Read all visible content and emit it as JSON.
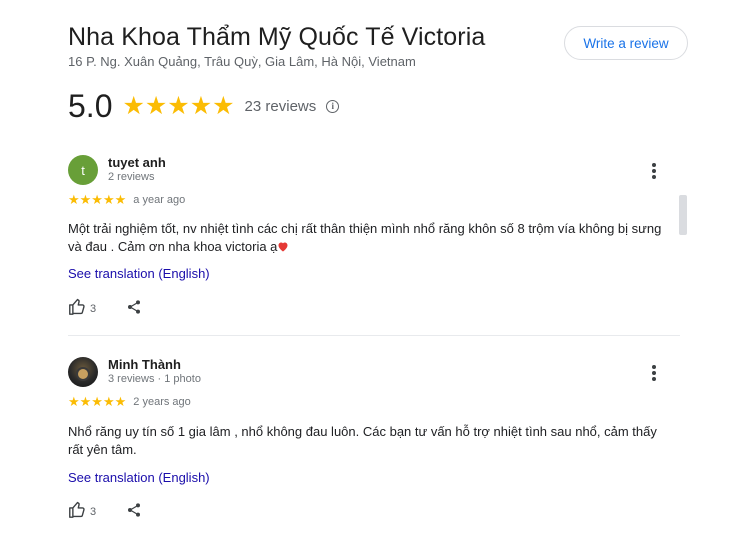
{
  "place": {
    "title": "Nha Khoa Thẩm Mỹ Quốc Tế Victoria",
    "address": "16 P. Ng. Xuân Quảng, Trâu Quỳ, Gia Lâm, Hà Nội, Vietnam"
  },
  "write_review_label": "Write a review",
  "summary": {
    "rating": "5.0",
    "stars": "★★★★★",
    "count_label": "23 reviews",
    "info_glyph": "i"
  },
  "reviews": [
    {
      "avatar_letter": "t",
      "author": "tuyet anh",
      "meta": "2 reviews",
      "stars": "★★★★★",
      "date": "a year ago",
      "text": "Một trải nghiệm tốt, nv nhiệt tình các chị rất thân thiện mình nhổ răng khôn số 8 trộm vía không bị sưng và đau . Cảm ơn nha khoa victoria ạ",
      "emoji": "❤️",
      "translate_label": "See translation (English)",
      "likes": "3"
    },
    {
      "author": "Minh Thành",
      "meta": "3 reviews · 1 photo",
      "stars": "★★★★★",
      "date": "2 years ago",
      "text": "Nhổ răng uy tín số 1 gia lâm , nhổ không đau luôn. Các bạn tư vấn hỗ trợ nhiệt tình sau nhổ, cảm thấy rất yên tâm.",
      "translate_label": "See translation (English)",
      "likes": "3"
    }
  ],
  "icons": {
    "more": "more-vert-icon",
    "like": "thumb-up-icon",
    "share": "share-icon",
    "info": "info-icon"
  },
  "colors": {
    "star": "#fbbc04",
    "link": "#1a0dab",
    "button_text": "#1a73e8",
    "avatar_t": "#689f38"
  }
}
